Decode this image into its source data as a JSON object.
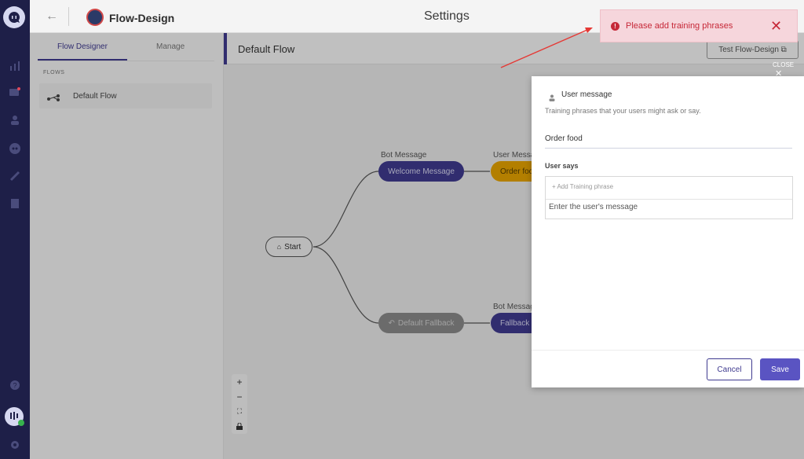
{
  "header": {
    "app_name": "Flow-Design",
    "page_title": "Settings"
  },
  "left_panel": {
    "tabs": [
      {
        "label": "Flow Designer",
        "active": true
      },
      {
        "label": "Manage",
        "active": false
      }
    ],
    "section_label": "FLOWS",
    "flows": [
      {
        "label": "Default Flow"
      }
    ]
  },
  "canvas": {
    "title": "Default Flow",
    "test_button": "Test Flow-Design ⧉",
    "nodes": {
      "start": "Start",
      "welcome_caption": "Bot Message",
      "welcome": "Welcome Message",
      "order_caption": "User Message",
      "order": "Order food",
      "fallback": "Default Fallback",
      "fallback_bot_caption": "Bot Message",
      "fallback_bot": "Fallback"
    },
    "zoom_controls": [
      "+",
      "−",
      "⛶",
      "🔒"
    ]
  },
  "modal": {
    "close_label": "CLOSE",
    "title": "User message",
    "subtitle": "Training phrases that your users might ask or say.",
    "name_value": "Order food",
    "section_label": "User says",
    "add_phrase_placeholder": "+ Add Training phrase",
    "message_placeholder": "Enter the user's message",
    "cancel_label": "Cancel",
    "save_label": "Save"
  },
  "toast": {
    "message": "Please add training phrases"
  },
  "colors": {
    "rail": "#1e1f48",
    "accent": "#3f3a8f",
    "error": "#c62838",
    "toast_bg": "#f6d6dc"
  }
}
